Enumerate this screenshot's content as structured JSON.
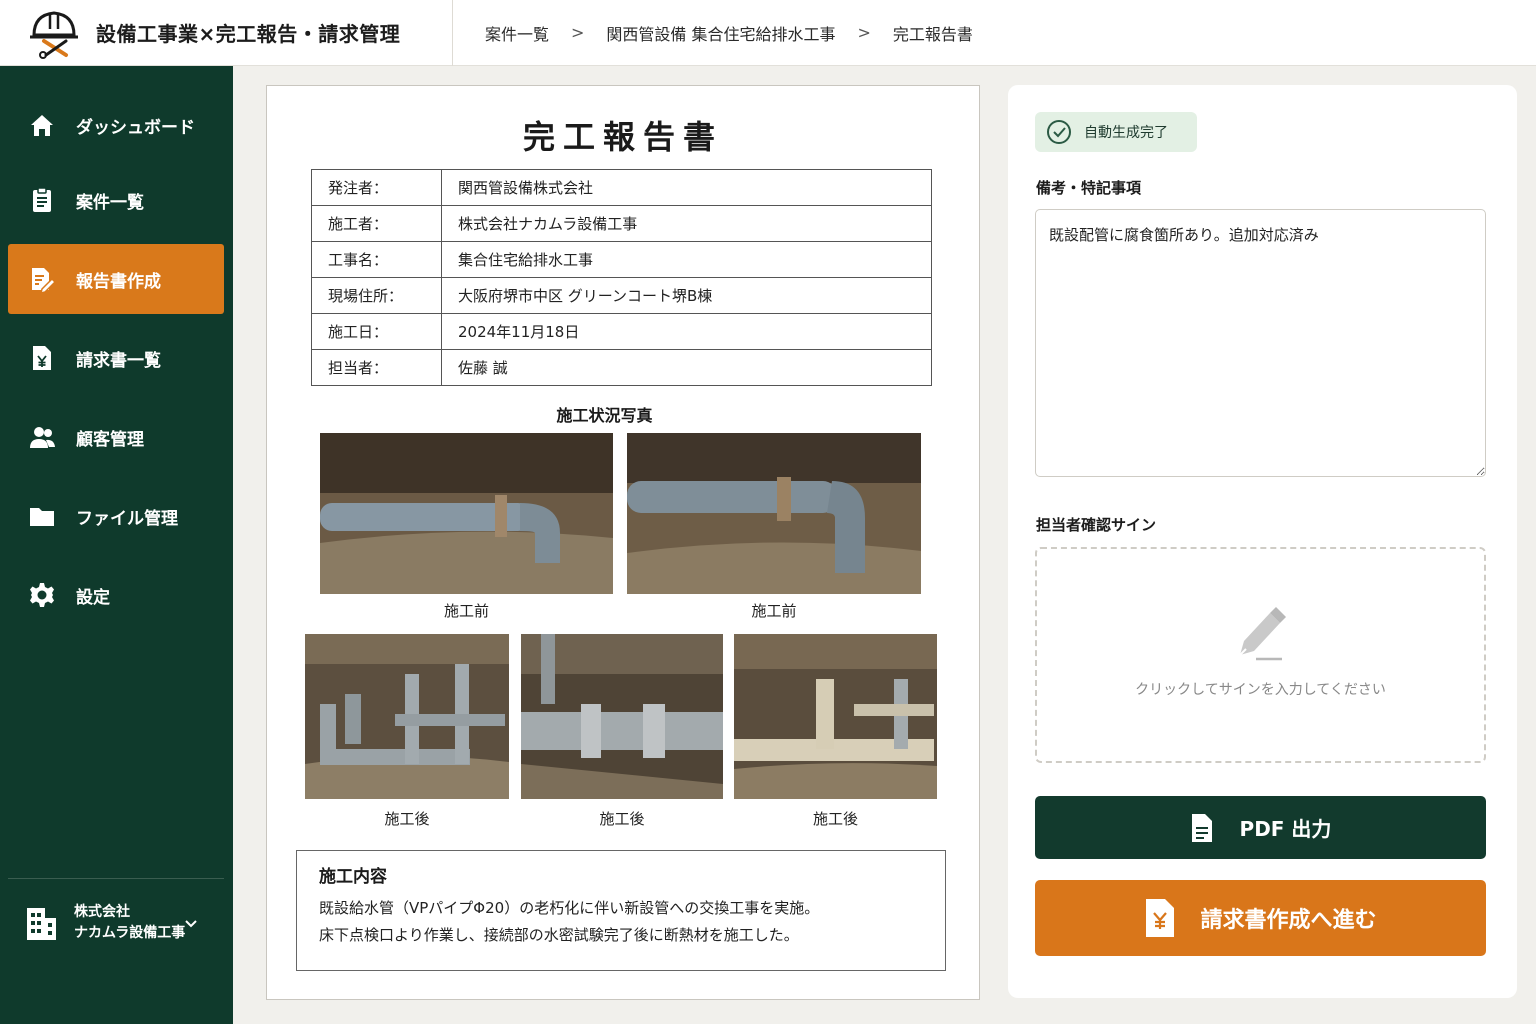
{
  "header": {
    "app_title": "設備工事業×完工報告・請求管理",
    "breadcrumb": [
      "案件一覧",
      "関西管設備 集合住宅給排水工事",
      "完工報告書"
    ]
  },
  "sidebar": {
    "items": [
      {
        "label": "ダッシュボード",
        "icon": "home-icon"
      },
      {
        "label": "案件一覧",
        "icon": "clipboard-icon"
      },
      {
        "label": "報告書作成",
        "icon": "report-edit-icon",
        "active": true
      },
      {
        "label": "請求書一覧",
        "icon": "invoice-yen-icon"
      },
      {
        "label": "顧客管理",
        "icon": "users-icon"
      },
      {
        "label": "ファイル管理",
        "icon": "folder-icon"
      },
      {
        "label": "設定",
        "icon": "gear-icon"
      }
    ],
    "company": {
      "line1": "株式会社",
      "line2": "ナカムラ設備工事"
    }
  },
  "report": {
    "title": "完工報告書",
    "fields": [
      {
        "key": "発注者：",
        "value": "関西管設備株式会社"
      },
      {
        "key": "施工者：",
        "value": "株式会社ナカムラ設備工事"
      },
      {
        "key": "工事名：",
        "value": "集合住宅給排水工事"
      },
      {
        "key": "現場住所：",
        "value": "大阪府堺市中区 グリーンコート堺B棟"
      },
      {
        "key": "施工日：",
        "value": "2024年11月18日"
      },
      {
        "key": "担当者：",
        "value": "佐藤 誠"
      }
    ],
    "photos_title": "施工状況写真",
    "photo_captions": [
      "施工前",
      "施工前",
      "施工後",
      "施工後",
      "施工後"
    ],
    "work_title": "施工内容",
    "work_lines": [
      "既設給水管（VPパイプΦ20）の老朽化に伴い新設管への交換工事を実施。",
      "床下点検口より作業し、接続部の水密試験完了後に断熱材を施工した。"
    ]
  },
  "panel": {
    "badge": "自動生成完了",
    "notes_label": "備考・特記事項",
    "notes_value": "既設配管に腐食箇所あり。追加対応済み",
    "sign_label": "担当者確認サイン",
    "sign_hint": "クリックしてサインを入力してください",
    "pdf_button": "PDF 出力",
    "invoice_button": "請求書作成へ進む"
  },
  "colors": {
    "sidebar": "#0f3a2c",
    "accent": "#d9791b",
    "primary_button": "#123a2d"
  }
}
